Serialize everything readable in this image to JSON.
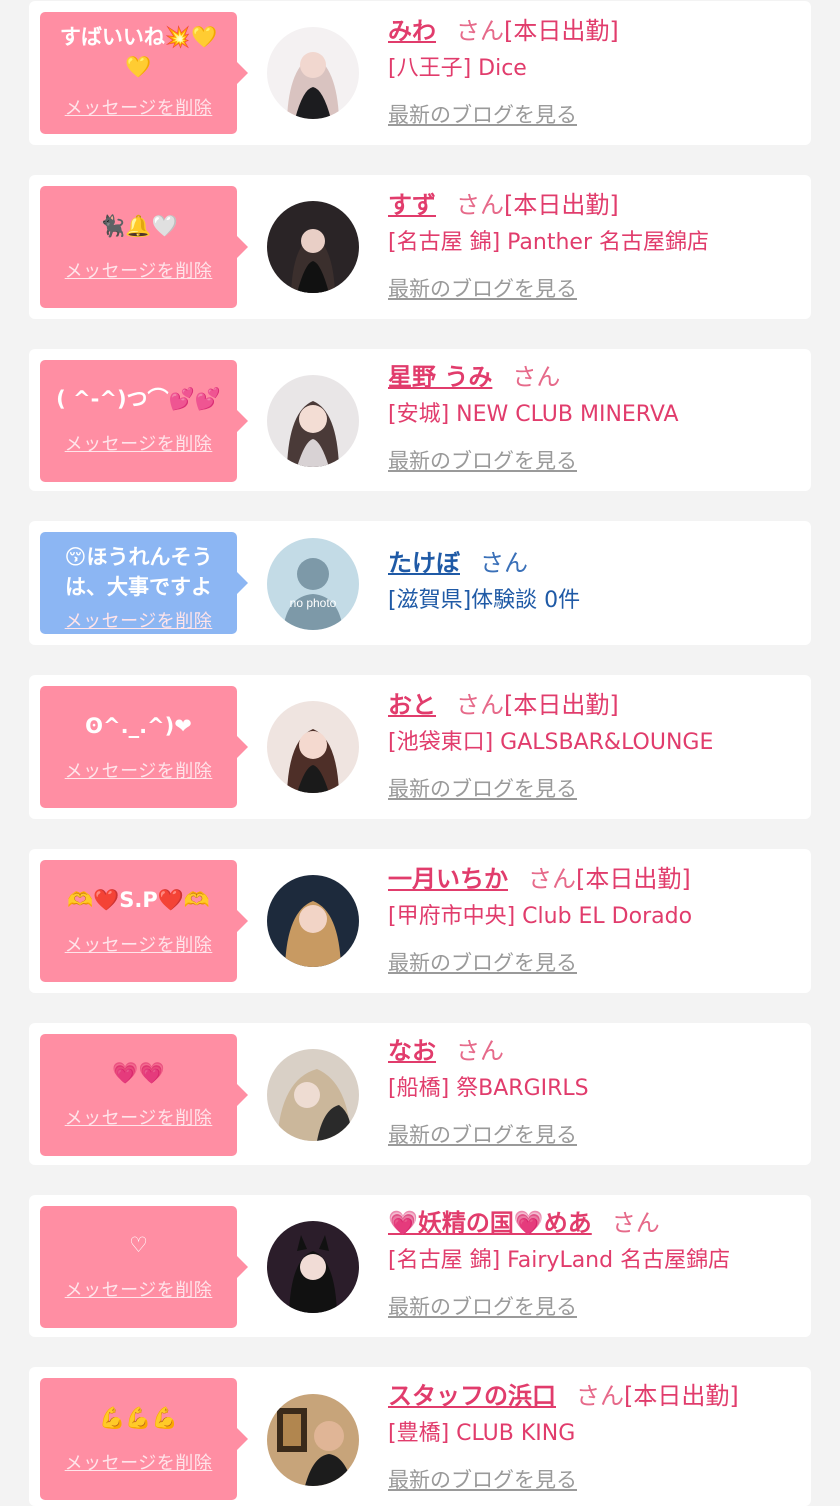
{
  "cards": [
    {
      "message": "すばいいね💥💛💛",
      "delete": "メッセージを削除",
      "name": "みわ",
      "san": "さん",
      "badge": "[本日出勤]",
      "shop": "[八王子] Dice",
      "blog": "最新のブログを見る"
    },
    {
      "message": "🐈‍⬛🔔🤍",
      "delete": "メッセージを削除",
      "name": "すず",
      "san": "さん",
      "badge": "[本日出勤]",
      "shop": "[名古屋 錦] Panther 名古屋錦店",
      "blog": "最新のブログを見る"
    },
    {
      "message": "( ^-^)つ⌒💕💕",
      "delete": "メッセージを削除",
      "name": "星野 うみ",
      "san": "さん",
      "badge": "",
      "shop": "[安城] NEW CLUB MINERVA",
      "blog": "最新のブログを見る"
    },
    {
      "message": "😚ほうれんそうは、大事ですよ",
      "delete": "メッセージを削除",
      "name": "たけぼ",
      "san": "さん",
      "badge": "",
      "shop": "[滋賀県]体験談 0件",
      "blog": "",
      "nophoto": "no photo"
    },
    {
      "message": "ʘ^._.^)❤",
      "delete": "メッセージを削除",
      "name": "おと",
      "san": "さん",
      "badge": "[本日出勤]",
      "shop": "[池袋東口] GALSBAR&LOUNGE",
      "blog": "最新のブログを見る"
    },
    {
      "message": "🫶❤️S.P❤️🫶",
      "delete": "メッセージを削除",
      "name": "一月いちか",
      "san": "さん",
      "badge": "[本日出勤]",
      "shop": "[甲府市中央] Club EL Dorado",
      "blog": "最新のブログを見る"
    },
    {
      "message": "💗💗",
      "delete": "メッセージを削除",
      "name": "なお",
      "san": "さん",
      "badge": "",
      "shop": "[船橋] 祭BARGIRLS",
      "blog": "最新のブログを見る"
    },
    {
      "message": "♡",
      "delete": "メッセージを削除",
      "name": "💗妖精の国💗めあ",
      "san": "さん",
      "badge": "",
      "shop": "[名古屋 錦] FairyLand 名古屋錦店",
      "blog": "最新のブログを見る"
    },
    {
      "message": "💪💪💪",
      "delete": "メッセージを削除",
      "name": "スタッフの浜口",
      "san": "さん",
      "badge": "[本日出勤]",
      "shop": "[豊橋] CLUB KING",
      "blog": "最新のブログを見る"
    }
  ],
  "colors": {
    "pink_bubble": "#ff8ea3",
    "blue_bubble": "#8cb6f3",
    "name_pink": "#e13c6c",
    "name_blue": "#1f5aa6"
  }
}
